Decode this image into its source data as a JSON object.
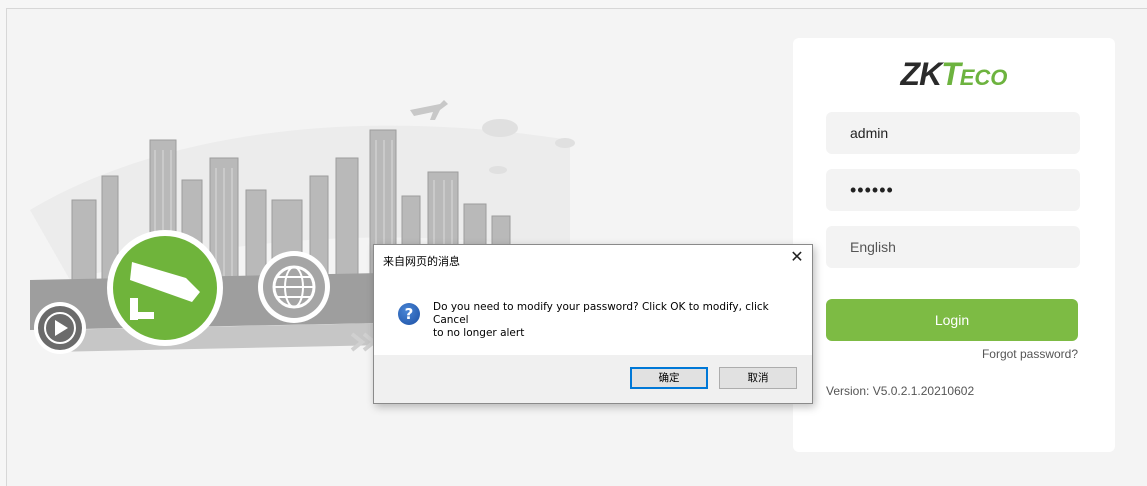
{
  "brand": {
    "logo_main": "ZK",
    "logo_t": "T",
    "logo_eco": "ECO"
  },
  "login": {
    "username": "admin",
    "password": "••••••",
    "language": "English",
    "login_label": "Login",
    "forgot_label": "Forgot password?",
    "version": "Version: V5.0.2.1.20210602"
  },
  "dialog": {
    "title": "来自网页的消息",
    "icon": "question-icon",
    "message_line1": "Do you need to modify your password? Click OK to modify, click Cancel",
    "message_line2": "to no longer alert",
    "ok_label": "确定",
    "cancel_label": "取消"
  },
  "colors": {
    "accent": "#7dbb44",
    "dialog_border": "#0078d7"
  }
}
